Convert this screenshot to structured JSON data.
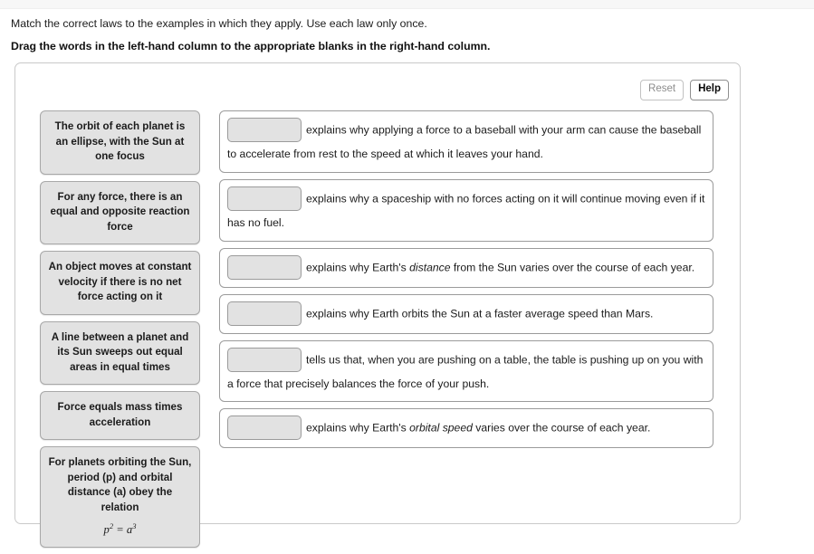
{
  "instructions": {
    "primary": "Match the correct laws to the examples in which they apply. Use each law only once.",
    "secondary": "Drag the words in the left-hand column to the appropriate blanks in the right-hand column."
  },
  "toolbar": {
    "reset_label": "Reset",
    "help_label": "Help"
  },
  "law_bank": {
    "items": [
      {
        "text": "The orbit of each planet is an ellipse, with the Sun at one focus"
      },
      {
        "text": "For any force, there is an equal and opposite reaction force"
      },
      {
        "text": "An object moves at constant velocity if there is no net force acting on it"
      },
      {
        "text": "A line between a planet and its Sun sweeps out equal areas in equal times"
      },
      {
        "text": "Force equals mass times acceleration"
      },
      {
        "text": "For planets orbiting the Sun, period (p) and orbital distance (a) obey the relation",
        "formula_base_1": "p",
        "formula_exp_1": "2",
        "formula_operator": " = ",
        "formula_base_2": "a",
        "formula_exp_2": "3"
      }
    ]
  },
  "statements": {
    "items": [
      {
        "blank_value": "",
        "parts": [
          {
            "type": "plain",
            "text": "explains why applying a force to a baseball with your arm can cause the baseball to accelerate from rest to the speed at which it leaves your hand."
          }
        ]
      },
      {
        "blank_value": "",
        "parts": [
          {
            "type": "plain",
            "text": "explains why a spaceship with no forces acting on it will continue moving even if it has no fuel."
          }
        ]
      },
      {
        "blank_value": "",
        "parts": [
          {
            "type": "plain",
            "text": "explains why Earth's "
          },
          {
            "type": "italic",
            "text": "distance"
          },
          {
            "type": "plain",
            "text": " from the Sun varies over the course of each year."
          }
        ]
      },
      {
        "blank_value": "",
        "parts": [
          {
            "type": "plain",
            "text": "explains why Earth orbits the Sun at a faster average speed than Mars."
          }
        ]
      },
      {
        "blank_value": "",
        "parts": [
          {
            "type": "plain",
            "text": "tells us that, when you are pushing on a table, the table is pushing up on you with a force that precisely balances the force of your push."
          }
        ]
      },
      {
        "blank_value": "",
        "parts": [
          {
            "type": "plain",
            "text": "explains why Earth's "
          },
          {
            "type": "italic",
            "text": "orbital speed"
          },
          {
            "type": "plain",
            "text": " varies over the course of each year."
          }
        ]
      }
    ]
  },
  "colors": {
    "tile_fill": "#e2e2e2",
    "tile_border": "#a8a8a8",
    "panel_border": "#c9c9c9",
    "statement_border": "#9b9b9b",
    "text": "#1b1b1b",
    "disabled_text": "#8d8d8d",
    "top_bar": "#f7f7f7"
  }
}
